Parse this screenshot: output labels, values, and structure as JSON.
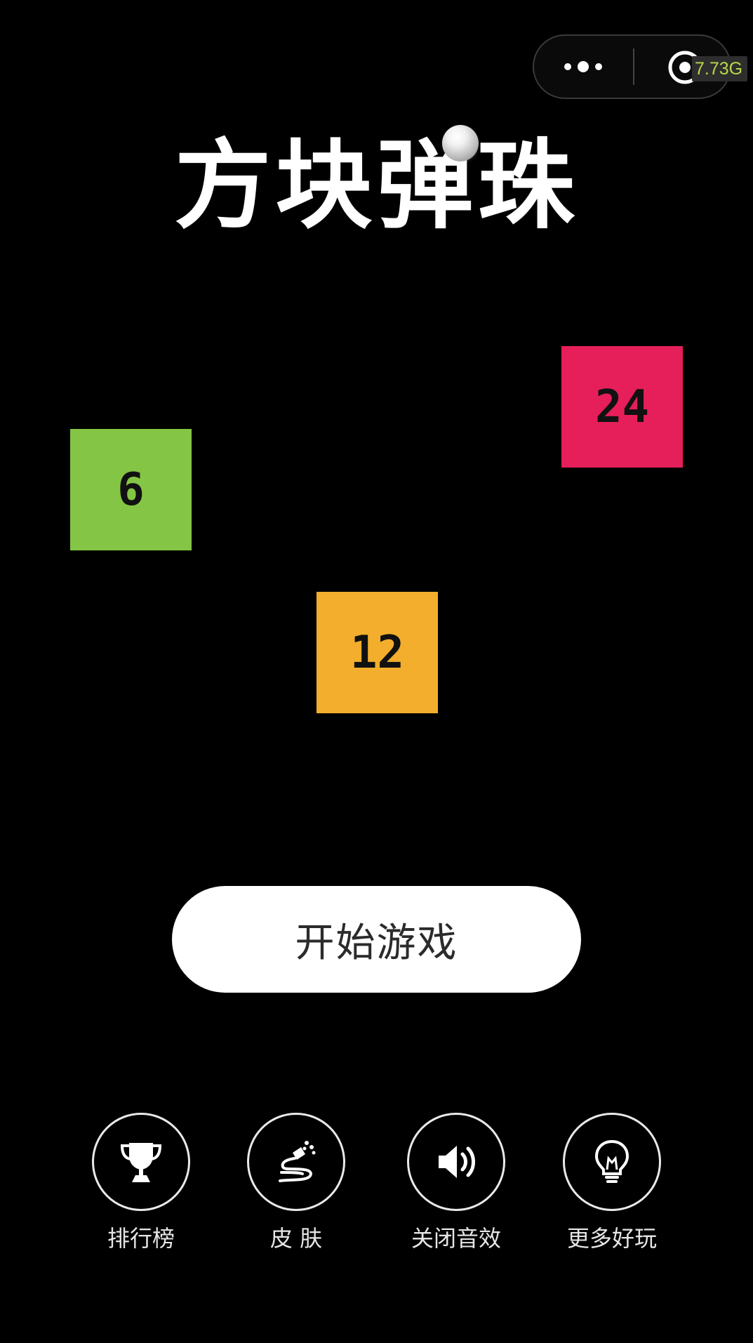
{
  "status": {
    "memory": "7.73G"
  },
  "title": "方块弹珠",
  "blocks": [
    {
      "value": "24",
      "color": "#e61e5a"
    },
    {
      "value": "6",
      "color": "#85c545"
    },
    {
      "value": "12",
      "color": "#f2ae2c"
    }
  ],
  "start_button": "开始游戏",
  "menu": [
    {
      "label": "排行榜",
      "icon": "trophy-icon"
    },
    {
      "label": "皮 肤",
      "icon": "brush-icon"
    },
    {
      "label": "关闭音效",
      "icon": "speaker-icon"
    },
    {
      "label": "更多好玩",
      "icon": "lightbulb-icon"
    }
  ]
}
